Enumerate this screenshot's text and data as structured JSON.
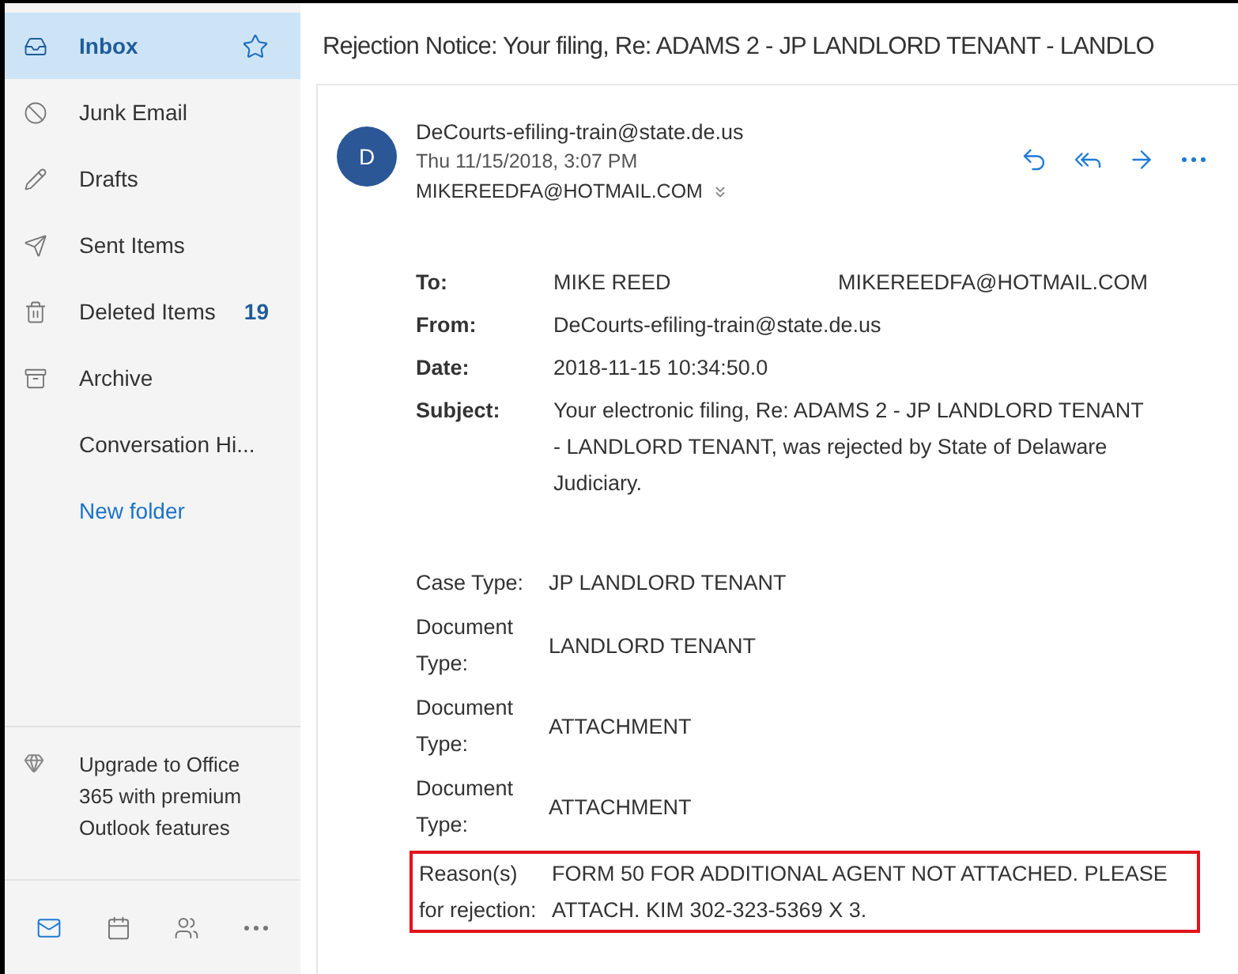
{
  "sidebar": {
    "folders": [
      {
        "kind": "inbox",
        "label": "Inbox",
        "selected": true,
        "favorite": true
      },
      {
        "kind": "junk",
        "label": "Junk Email",
        "selected": false
      },
      {
        "kind": "drafts",
        "label": "Drafts",
        "selected": false
      },
      {
        "kind": "sent",
        "label": "Sent Items",
        "selected": false
      },
      {
        "kind": "deleted",
        "label": "Deleted Items",
        "count": "19",
        "selected": false
      },
      {
        "kind": "archive",
        "label": "Archive",
        "selected": false
      },
      {
        "kind": "plain",
        "label": "Conversation Hi...",
        "selected": false
      },
      {
        "kind": "link",
        "label": "New folder",
        "selected": false
      }
    ],
    "upgrade": {
      "text": "Upgrade to Office 365 with premium Outlook features"
    },
    "nav": [
      {
        "kind": "mail",
        "selected": true
      },
      {
        "kind": "calendar",
        "selected": false
      },
      {
        "kind": "people",
        "selected": false
      },
      {
        "kind": "more",
        "selected": false
      }
    ]
  },
  "message": {
    "subject": "Rejection Notice: Your filing, Re: ADAMS 2 - JP LANDLORD TENANT - LANDLO",
    "avatar": "D",
    "sender": "DeCourts-efiling-train@state.de.us",
    "date": "Thu 11/15/2018, 3:07 PM",
    "recipient": "MIKEREEDFA@HOTMAIL.COM",
    "actions": [
      {
        "kind": "reply"
      },
      {
        "kind": "reply-all"
      },
      {
        "kind": "forward"
      },
      {
        "kind": "more"
      }
    ],
    "header_fields": [
      {
        "label": "To:",
        "value": "MIKE REED",
        "extra": "MIKEREEDFA@HOTMAIL.COM"
      },
      {
        "label": "From:",
        "value": "DeCourts-efiling-train@state.de.us"
      },
      {
        "label": "Date:",
        "value": "2018-11-15 10:34:50.0"
      },
      {
        "label": "Subject:",
        "value": "Your electronic filing, Re: ADAMS 2 - JP LANDLORD TENANT - LANDLORD TENANT, was rejected by State of Delaware Judiciary."
      }
    ],
    "details": [
      {
        "label": "Case Type:",
        "value": "JP LANDLORD TENANT",
        "highlighted": false
      },
      {
        "label": "Document Type:",
        "value": "LANDLORD TENANT",
        "highlighted": false
      },
      {
        "label": "Document Type:",
        "value": "ATTACHMENT",
        "highlighted": false
      },
      {
        "label": "Document Type:",
        "value": "ATTACHMENT",
        "highlighted": false
      },
      {
        "label": "Reason(s) for rejection:",
        "value": "FORM 50 FOR ADDITIONAL AGENT NOT ATTACHED. PLEASE ATTACH. KIM 302-323-5369 X 3.",
        "highlighted": true
      }
    ]
  }
}
